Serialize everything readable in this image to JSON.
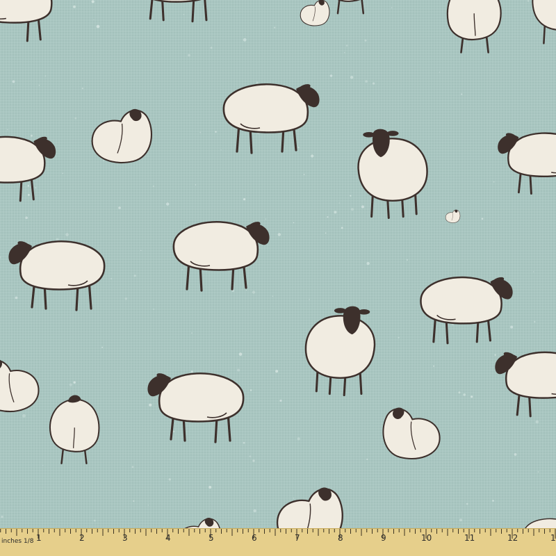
{
  "colors": {
    "background": "#a9c6c1",
    "wool": "#f1ece1",
    "outline": "#3d302c",
    "ruler": "#e6cf8b"
  },
  "pattern": {
    "motif": "sheep-icon",
    "sheep_count": 24
  },
  "ruler": {
    "unit_label": "inches 1/8",
    "numbers": [
      "1",
      "2",
      "3",
      "4",
      "5",
      "6",
      "7",
      "8",
      "9",
      "10",
      "11",
      "12",
      "1"
    ]
  }
}
